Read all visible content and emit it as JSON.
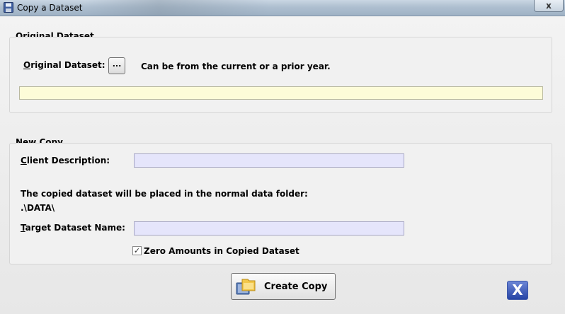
{
  "window": {
    "title": "Copy a Dataset",
    "close_glyph": "x",
    "icon": "floppy-disk-icon"
  },
  "original_group": {
    "title": "Original Dataset",
    "label_accel": "O",
    "label_rest": "riginal Dataset:",
    "browse_label": "...",
    "hint": "Can be from the current or a prior year.",
    "path_value": ""
  },
  "new_copy_group": {
    "title": "New Copy",
    "client_desc_accel": "C",
    "client_desc_rest": "lient Description:",
    "client_desc_value": "",
    "placement_note": "The copied dataset will be placed in the normal data folder:",
    "data_folder": ".\\DATA\\",
    "target_accel": "T",
    "target_rest": "arget Dataset Name:",
    "target_value": "",
    "zero_amounts_label": "Zero Amounts in Copied Dataset",
    "zero_amounts_checked": true
  },
  "actions": {
    "create_copy_label": "Create Copy",
    "create_copy_icon": "copy-folder-icon",
    "exit_icon": "close-x-icon",
    "exit_glyph": "X"
  },
  "colors": {
    "yellow_field": "#fdfcd8",
    "blue_field": "#e5e5fb",
    "exit_button": "#2745a6"
  }
}
